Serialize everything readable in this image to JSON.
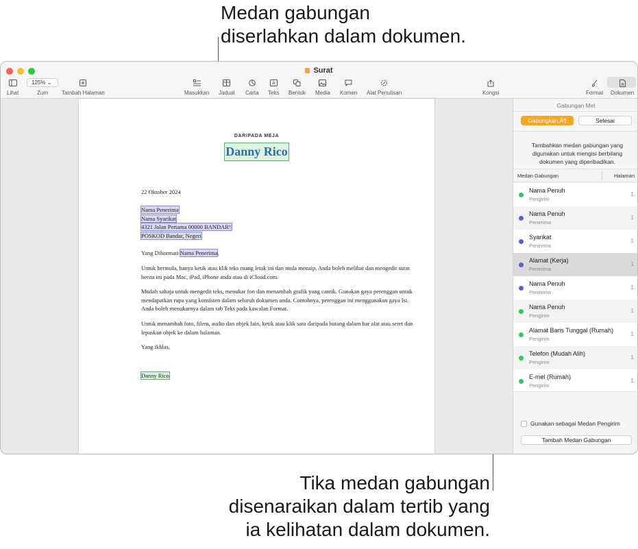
{
  "callouts": {
    "top_line1": "Medan gabungan",
    "top_line2": "diserlahkan dalam dokumen.",
    "bottom_line1": "Tika medan gabungan",
    "bottom_line2": "disenaraikan dalam tertib yang",
    "bottom_line3": "ia kelihatan dalam dokumen."
  },
  "window": {
    "title": "Surat"
  },
  "toolbar": {
    "view_label": "Lihat",
    "zoom_value": "125%",
    "zoom_label": "Zum",
    "add_page_label": "Tambah Halaman",
    "insert_label": "Masukkan",
    "table_label": "Jadual",
    "chart_label": "Carta",
    "text_label": "Teks",
    "shape_label": "Bentuk",
    "media_label": "Media",
    "comment_label": "Komen",
    "writing_tools_label": "Alat Penulisan",
    "share_label": "Kongsi",
    "format_label": "Format",
    "document_label": "Dokumen"
  },
  "document": {
    "header_caps": "DARIPADA MEJA",
    "sender_name": "Danny Rico",
    "date": "22 Oktober 2024",
    "recipient_name": "Nama Penerima",
    "company": "Nama Syarikat",
    "address_line": "4321 Jalan Pertama 00000 BANDAR",
    "address_mark": "¶",
    "postcode_line": "POSKOD Bandar, Negeri",
    "greeting_prefix": "Yang Dihormati ",
    "greeting_field": "Nama Penerima",
    "greeting_suffix": ",",
    "para1": "Untuk bermula, hanya ketik atau klik teks ruang letak ini dan mula menaip. Anda boleh melihat dan mengedit surat berita ini pada Mac, iPad, iPhone anda atau di iCloud.com.",
    "para2": "Mudah sahaja untuk mengedit teks, menukar fon dan menambah grafik yang cantik. Gunakan gaya perenggan untuk mendapatkan rupa yang konsisten dalam seluruh dokumen anda. Contohnya, perenggan ini menggunakan gaya Isi. Anda boleh menukarnya dalam tab Teks pada kawalan Format.",
    "para3": "Untuk menambah foto, filem, audio dan objek lain, ketik atau klik satu daripada butang dalam bar alat atau seret dan lepaskan objek ke dalam halaman.",
    "closing": "Yang ikhlas,",
    "signature": "Danny Rico"
  },
  "sidebar": {
    "title": "Gabungan Mel",
    "merge_button": "Gabungkan,Â¶",
    "done_button": "Selesai",
    "description": "Tambahkan medan gabungan yang digunakan untuk mengisi berbilang dokumen yang diperibadikan.",
    "col_field": "Medan Gabungan",
    "col_page": "Halaman",
    "use_as_sender": "Gunakan sebagai Medan Pengirim",
    "add_field_button": "Tambah Medan Gabungan",
    "fields": [
      {
        "name": "Nama Penuh",
        "type": "Pengirim",
        "page": "1",
        "color": "#34c759"
      },
      {
        "name": "Nama Penuh",
        "type": "Penerima",
        "page": "1",
        "color": "#5a5fd6"
      },
      {
        "name": "Syarikat",
        "type": "Penerima",
        "page": "1",
        "color": "#5a5fd6"
      },
      {
        "name": "Alamat (Kerja)",
        "type": "Penerima",
        "page": "1",
        "color": "#5a5fd6"
      },
      {
        "name": "Nama Penuh",
        "type": "Penerima",
        "page": "1",
        "color": "#5a5fd6"
      },
      {
        "name": "Nama Penuh",
        "type": "Pengirim",
        "page": "1",
        "color": "#34c759"
      },
      {
        "name": "Alamat Baris Tunggal (Rumah)",
        "type": "Pengirim",
        "page": "1",
        "color": "#34c759"
      },
      {
        "name": "Telefon (Mudah Alih)",
        "type": "Pengirim",
        "page": "1",
        "color": "#34c759"
      },
      {
        "name": "E-mel (Rumah)",
        "type": "Pengirim",
        "page": "1",
        "color": "#34c759"
      }
    ]
  }
}
